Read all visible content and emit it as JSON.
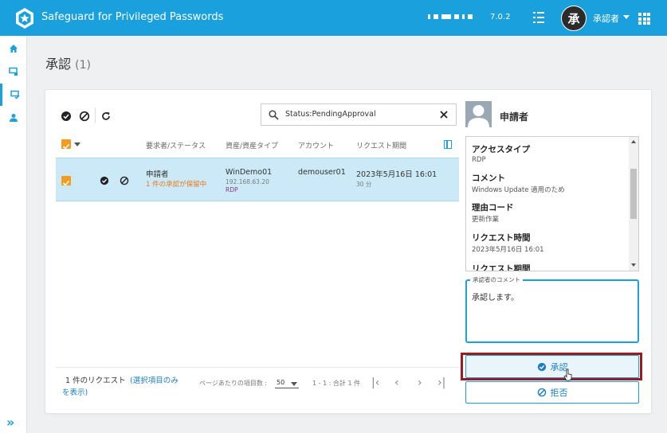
{
  "header": {
    "app_title": "Safeguard for Privileged Passwords",
    "version": "7.0.2",
    "avatar_letter": "承",
    "user_name": "承認者"
  },
  "page": {
    "title": "承認",
    "count": "(1)"
  },
  "search": {
    "value": "Status:PendingApproval"
  },
  "table": {
    "columns": [
      "要求者/ステータス",
      "資産/資産タイプ",
      "アカウント",
      "リクエスト期間"
    ],
    "row": {
      "requester": "申請者",
      "status": "1 件の承認が保留中",
      "asset": "WinDemo01",
      "ip": "192.168.63.20",
      "type": "RDP",
      "account": "demouser01",
      "time": "2023年5月16日 16:01",
      "duration": "30 分"
    }
  },
  "footer": {
    "count_text": "1 件のリクエスト",
    "link_line1": "(選択項目のみ",
    "link_line2": "を表示)",
    "per_page_label": "ページあたりの項目数 :",
    "per_page_value": "50",
    "range": "1 - 1 : 合計 1 件"
  },
  "detail": {
    "name": "申請者",
    "fields": [
      {
        "label": "アクセスタイプ",
        "value": "RDP"
      },
      {
        "label": "コメント",
        "value": "Windows Update 適用のため"
      },
      {
        "label": "理由コード",
        "value": "更新作業"
      },
      {
        "label": "リクエスト時間",
        "value": "2023年5月16日 16:01"
      },
      {
        "label": "リクエスト期間",
        "value": ""
      }
    ],
    "comment_label": "承認者のコメント",
    "comment_text": "承認します。",
    "approve_label": "承認",
    "deny_label": "拒否"
  },
  "colors": {
    "brand": "#1aa1dd",
    "highlight": "#9b1b1e",
    "checkbox": "#f39c1f",
    "selected_row": "#cbe9f6"
  }
}
